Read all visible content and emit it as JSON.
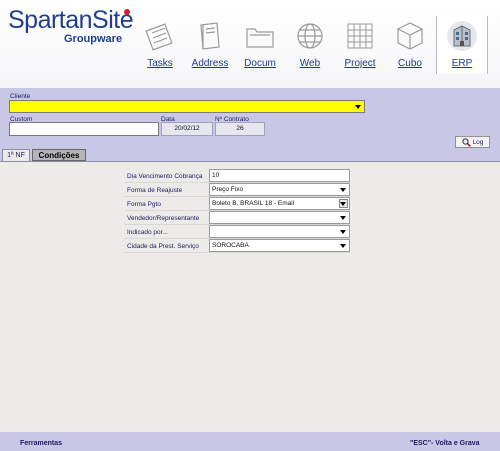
{
  "logo": {
    "name": "SpartanSite",
    "sub": "Groupware"
  },
  "nav": [
    {
      "label": "Tasks",
      "icon": "tasks-icon"
    },
    {
      "label": "Address",
      "icon": "address-book-icon"
    },
    {
      "label": "Docum",
      "icon": "documents-icon"
    },
    {
      "label": "Web",
      "icon": "web-globe-icon"
    },
    {
      "label": "Project",
      "icon": "project-icon"
    },
    {
      "label": "Cubo",
      "icon": "cube-icon"
    },
    {
      "label": "ERP",
      "icon": "erp-building-icon",
      "active": true
    }
  ],
  "form": {
    "cliente_label": "Cliente",
    "cliente_value": "",
    "custom_label": "Custom",
    "custom_value": "",
    "data_label": "Data",
    "data_value": "20/02/12",
    "contrato_label": "Nº Contrato",
    "contrato_value": "26",
    "log_label": "Log"
  },
  "tabs": [
    {
      "label": "1ª NF",
      "active": false
    },
    {
      "label": "Condições",
      "active": true
    }
  ],
  "conditions": [
    {
      "label": "Dia Vencimento Cobrança",
      "value": "10",
      "control": "text"
    },
    {
      "label": "Forma de Reajuste",
      "value": "Preço Fixo",
      "control": "dropdown"
    },
    {
      "label": "Forma Pgto",
      "value": "Boleto B. BRASIL 18 - Email",
      "control": "dropdown-button"
    },
    {
      "label": "Vendedor/Representante",
      "value": "",
      "control": "dropdown"
    },
    {
      "label": "Indicado por...",
      "value": "",
      "control": "dropdown"
    },
    {
      "label": "Cidade da Prest. Serviço",
      "value": "SOROCABA",
      "control": "dropdown"
    }
  ],
  "footer": {
    "tools": "Ferramentas",
    "esc": "\"ESC\"- Volta e Grava"
  },
  "colors": {
    "brand": "#1f3f8c",
    "band": "#c8c8e6",
    "cliente_highlight": "#ffff00",
    "body": "#ecebe8"
  }
}
